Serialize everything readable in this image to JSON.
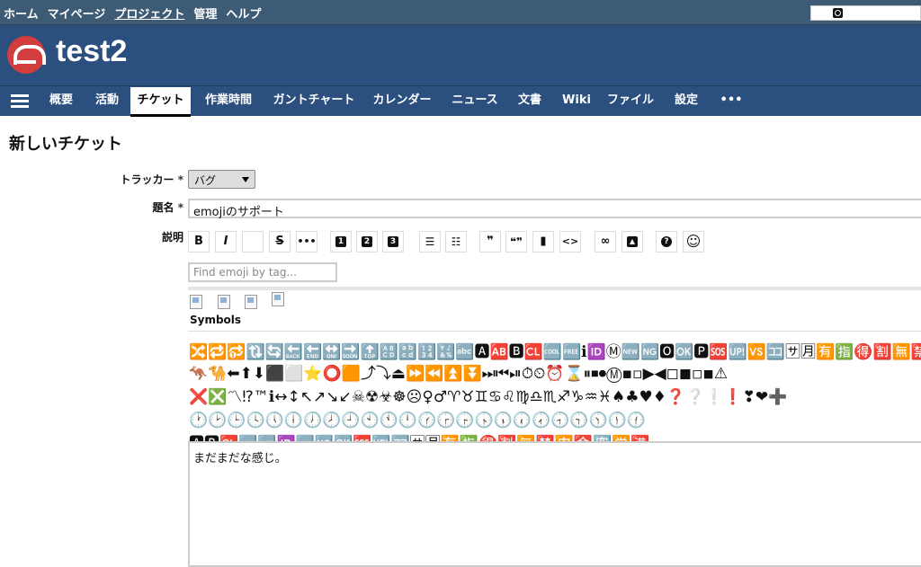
{
  "top_menu": {
    "items": [
      {
        "label": "ホーム",
        "active": false
      },
      {
        "label": "マイページ",
        "active": false
      },
      {
        "label": "プロジェクト",
        "active": true
      },
      {
        "label": "管理",
        "active": false
      },
      {
        "label": "ヘルプ",
        "active": false
      }
    ]
  },
  "header": {
    "project_title": "test2"
  },
  "main_menu": {
    "tabs": [
      {
        "label": "概要"
      },
      {
        "label": "活動"
      },
      {
        "label": "チケット",
        "selected": true
      },
      {
        "label": "作業時間"
      },
      {
        "label": "ガントチャート"
      },
      {
        "label": "カレンダー"
      },
      {
        "label": "ニュース"
      },
      {
        "label": "文書"
      },
      {
        "label": "Wiki"
      },
      {
        "label": "ファイル"
      },
      {
        "label": "設定"
      },
      {
        "label": "•••"
      }
    ]
  },
  "page": {
    "title": "新しいチケット"
  },
  "form": {
    "tracker_label": "トラッカー",
    "tracker_value": "バグ",
    "subject_label": "題名",
    "subject_value": "emojiのサポート",
    "description_label": "説明",
    "required_mark": "*",
    "description_value": "まだまだな感じ。"
  },
  "toolbar": {
    "buttons": [
      {
        "name": "bold-button",
        "text": "B"
      },
      {
        "name": "italic-button",
        "text": "I"
      },
      {
        "name": "blank-button",
        "text": ""
      },
      {
        "name": "strike-button",
        "text": "S"
      },
      {
        "name": "hr-button",
        "text": "•••"
      },
      {
        "name": "h1-button",
        "text": "1"
      },
      {
        "name": "h2-button",
        "text": "2"
      },
      {
        "name": "h3-button",
        "text": "3"
      },
      {
        "name": "ul-button",
        "text": ""
      },
      {
        "name": "ol-button",
        "text": ""
      },
      {
        "name": "quote-button",
        "text": "❞"
      },
      {
        "name": "unquote-button",
        "text": ""
      },
      {
        "name": "pre-button",
        "text": ""
      },
      {
        "name": "code-button",
        "text": "<>"
      },
      {
        "name": "link-button",
        "text": ""
      },
      {
        "name": "image-button",
        "text": ""
      },
      {
        "name": "help-button",
        "text": "?"
      },
      {
        "name": "emoji-button",
        "text": "☺"
      }
    ]
  },
  "emoji_picker": {
    "search_placeholder": "Find emoji by tag...",
    "category_title": "Symbols",
    "rows": [
      "🔀🔁🔂🔃🔄🔙🔚🔛🔜🔝🔠🔡🔢🔣🔤🅰🆎🅱🆑🆒🆓ℹ🆔Ⓜ🆕🆖🅾🆗🅿🆘🆙🆚🈁🈂🈷🈶🈯🉐🈹🈚🈲🉑🈸🈴🈳",
      "🦘🐪⬅⬆⬇⬛⬜⭐⭕🟧⤴⤵⏏⏩⏪⏫⏬⏭⏮⏯⏱⏲⏰⌛⏸⏹⏺Ⓜ▪▫▶◀◻◼◽◾⚠",
      "❌❎〽⁉™ℹ↔↕↖↗↘↙☠☢☣☸☹♀♂♈♉♊♋♌♍♎♏♐♑♒♓♠♣♥♦❓❔❕❗❣❤➕",
      "🕐🕑🕒🕓🕔🕕🕖🕗🕘🕙🕚🕛🕜🕝🕞🕟🕠🕡🕢🕣🕤🕥🕦🕧",
      "🅰🅱🆑🆒🆓🆔🆕🆖🆗🆘🆙🈁🈂🈷🈶🈯🉐🈹🈚🈲🈸🈴🈳🈺🈵"
    ]
  }
}
